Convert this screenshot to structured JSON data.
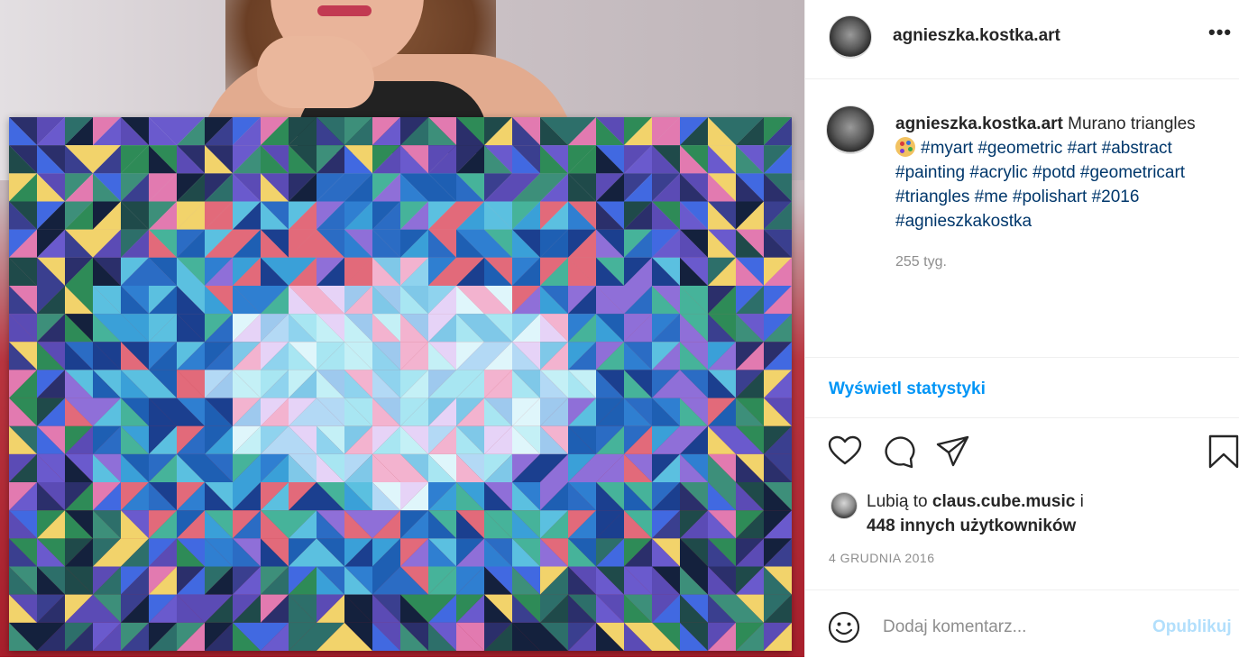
{
  "post": {
    "username": "agnieszka.kostka.art",
    "more_icon": "•••",
    "caption": {
      "username": "agnieszka.kostka.art",
      "text": "Murano triangles",
      "emoji": "artist-palette-icon",
      "hashtags": [
        "#myart",
        "#geometric",
        "#art",
        "#abstract",
        "#painting",
        "#acrylic",
        "#potd",
        "#geometricart",
        "#triangles",
        "#me",
        "#polishart",
        "#2016",
        "#agnieszkakostka"
      ],
      "age": "255 tyg."
    },
    "view_stats": "Wyświetl statystyki",
    "likes": {
      "prefix": "Lubią to",
      "user": "claus.cube.music",
      "conj": "i",
      "others": "448 innych użytkowników"
    },
    "date": "4 GRUDNIA 2016",
    "comment": {
      "placeholder": "Dodaj komentarz...",
      "publish": "Opublikuj"
    }
  },
  "colors": {
    "accent": "#0095f6",
    "hashtag": "#00376b",
    "muted": "#8e8e8e",
    "publish_disabled": "#b2dffc"
  }
}
